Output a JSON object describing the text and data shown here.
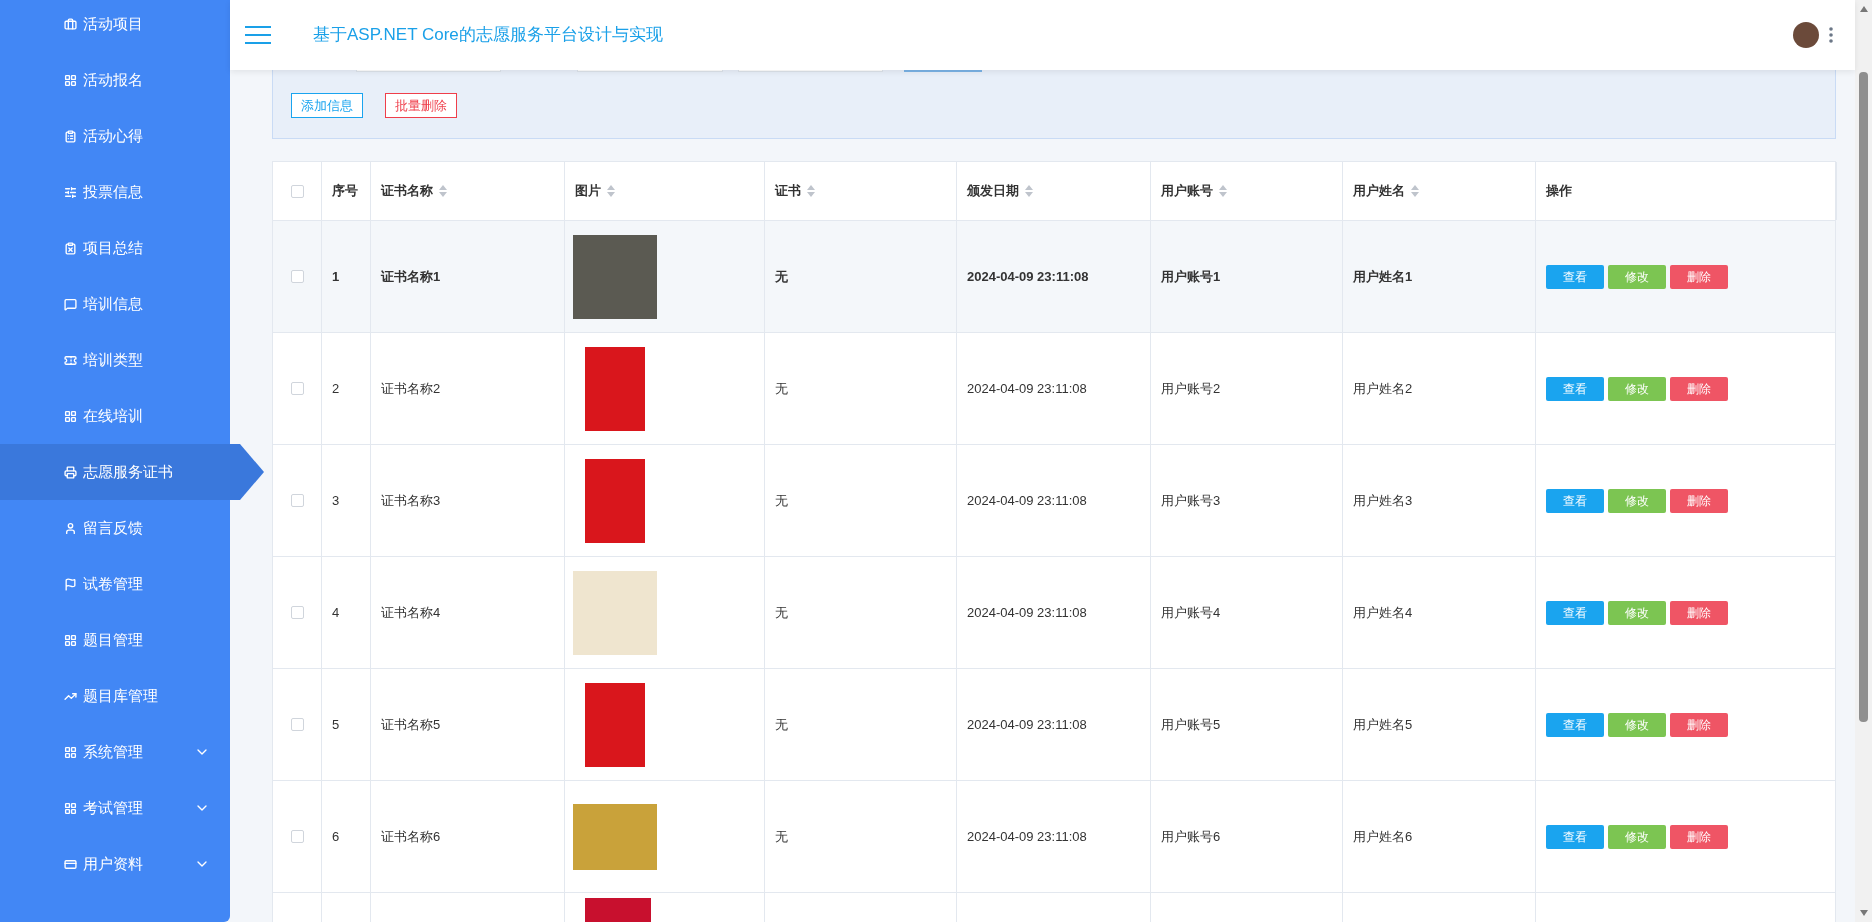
{
  "sidebar": {
    "items": [
      {
        "kind": "link",
        "label": "活动项目",
        "selected": false
      },
      {
        "kind": "link",
        "label": "活动报名",
        "selected": false
      },
      {
        "kind": "link",
        "label": "活动心得",
        "selected": false
      },
      {
        "kind": "link",
        "label": "投票信息",
        "selected": false
      },
      {
        "kind": "link",
        "label": "项目总结",
        "selected": false
      },
      {
        "kind": "link",
        "label": "培训信息",
        "selected": false
      },
      {
        "kind": "link",
        "label": "培训类型",
        "selected": false
      },
      {
        "kind": "link",
        "label": "在线培训",
        "selected": false
      },
      {
        "kind": "link",
        "label": "志愿服务证书",
        "selected": true
      },
      {
        "kind": "link",
        "label": "留言反馈",
        "selected": false
      },
      {
        "kind": "link",
        "label": "试卷管理",
        "selected": false
      },
      {
        "kind": "link",
        "label": "题目管理",
        "selected": false
      },
      {
        "kind": "link",
        "label": "题目库管理",
        "selected": false
      },
      {
        "kind": "group",
        "label": "系统管理",
        "selected": false,
        "expanded": false
      },
      {
        "kind": "group",
        "label": "考试管理",
        "selected": false,
        "expanded": false
      },
      {
        "kind": "group",
        "label": "用户资料",
        "selected": false,
        "expanded": false
      }
    ]
  },
  "header": {
    "title": "基于ASP.NET Core的志愿服务平台设计与实现"
  },
  "toolbar": {
    "buttons": [
      {
        "kind": "add",
        "label": "添加信息"
      },
      {
        "kind": "delete",
        "label": "批量删除"
      }
    ]
  },
  "table": {
    "select_all": {
      "checked": false
    },
    "columns": [
      {
        "label": "序号",
        "sortable": false
      },
      {
        "label": "证书名称",
        "sortable": true
      },
      {
        "label": "图片",
        "sortable": true
      },
      {
        "label": "证书",
        "sortable": true
      },
      {
        "label": "颁发日期",
        "sortable": true
      },
      {
        "label": "用户账号",
        "sortable": true
      },
      {
        "label": "用户姓名",
        "sortable": true
      },
      {
        "label": "操作",
        "sortable": false
      }
    ],
    "rows": [
      {
        "checked": false,
        "hovered": true,
        "index": "1",
        "name": "证书名称1",
        "certificate": "无",
        "date": "2024-04-09 23:11:08",
        "account": "用户账号1",
        "user_name": "用户姓名1",
        "actions": [
          {
            "kind": "view",
            "label": "查看"
          },
          {
            "kind": "edit",
            "label": "修改"
          },
          {
            "kind": "delete",
            "label": "删除"
          }
        ]
      },
      {
        "checked": false,
        "hovered": false,
        "index": "2",
        "name": "证书名称2",
        "certificate": "无",
        "date": "2024-04-09 23:11:08",
        "account": "用户账号2",
        "user_name": "用户姓名2",
        "actions": [
          {
            "kind": "view",
            "label": "查看"
          },
          {
            "kind": "edit",
            "label": "修改"
          },
          {
            "kind": "delete",
            "label": "删除"
          }
        ]
      },
      {
        "checked": false,
        "hovered": false,
        "index": "3",
        "name": "证书名称3",
        "certificate": "无",
        "date": "2024-04-09 23:11:08",
        "account": "用户账号3",
        "user_name": "用户姓名3",
        "actions": [
          {
            "kind": "view",
            "label": "查看"
          },
          {
            "kind": "edit",
            "label": "修改"
          },
          {
            "kind": "delete",
            "label": "删除"
          }
        ]
      },
      {
        "checked": false,
        "hovered": false,
        "index": "4",
        "name": "证书名称4",
        "certificate": "无",
        "date": "2024-04-09 23:11:08",
        "account": "用户账号4",
        "user_name": "用户姓名4",
        "actions": [
          {
            "kind": "view",
            "label": "查看"
          },
          {
            "kind": "edit",
            "label": "修改"
          },
          {
            "kind": "delete",
            "label": "删除"
          }
        ]
      },
      {
        "checked": false,
        "hovered": false,
        "index": "5",
        "name": "证书名称5",
        "certificate": "无",
        "date": "2024-04-09 23:11:08",
        "account": "用户账号5",
        "user_name": "用户姓名5",
        "actions": [
          {
            "kind": "view",
            "label": "查看"
          },
          {
            "kind": "edit",
            "label": "修改"
          },
          {
            "kind": "delete",
            "label": "删除"
          }
        ]
      },
      {
        "checked": false,
        "hovered": false,
        "index": "6",
        "name": "证书名称6",
        "certificate": "无",
        "date": "2024-04-09 23:11:08",
        "account": "用户账号6",
        "user_name": "用户姓名6",
        "actions": [
          {
            "kind": "view",
            "label": "查看"
          },
          {
            "kind": "edit",
            "label": "修改"
          },
          {
            "kind": "delete",
            "label": "删除"
          }
        ]
      }
    ]
  }
}
